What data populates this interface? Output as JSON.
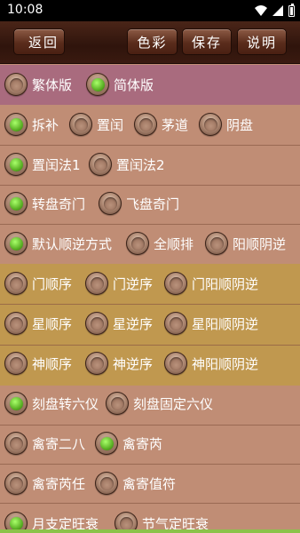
{
  "status_bar": {
    "time": "10:08"
  },
  "toolbar": {
    "back_label": "返回",
    "color_label": "色彩",
    "save_label": "保存",
    "help_label": "说明"
  },
  "options": {
    "script": [
      {
        "label": "繁体版",
        "checked": false
      },
      {
        "label": "简体版",
        "checked": true
      }
    ],
    "method1": [
      {
        "label": "拆补",
        "checked": true
      },
      {
        "label": "置闰",
        "checked": false
      },
      {
        "label": "茅道",
        "checked": false
      },
      {
        "label": "阴盘",
        "checked": false
      }
    ],
    "method2": [
      {
        "label": "置闰法1",
        "checked": true
      },
      {
        "label": "置闰法2",
        "checked": false
      }
    ],
    "plate": [
      {
        "label": "转盘奇门",
        "checked": true
      },
      {
        "label": "飞盘奇门",
        "checked": false
      }
    ],
    "order_mode": [
      {
        "label": "默认顺逆方式",
        "checked": true
      },
      {
        "label": "全顺排",
        "checked": false
      },
      {
        "label": "阳顺阴逆",
        "checked": false
      }
    ],
    "door_order": [
      {
        "label": "门顺序",
        "checked": false
      },
      {
        "label": "门逆序",
        "checked": false
      },
      {
        "label": "门阳顺阴逆",
        "checked": false
      }
    ],
    "star_order": [
      {
        "label": "星顺序",
        "checked": false
      },
      {
        "label": "星逆序",
        "checked": false
      },
      {
        "label": "星阳顺阴逆",
        "checked": false
      }
    ],
    "god_order": [
      {
        "label": "神顺序",
        "checked": false
      },
      {
        "label": "神逆序",
        "checked": false
      },
      {
        "label": "神阳顺阴逆",
        "checked": false
      }
    ],
    "liuyi": [
      {
        "label": "刻盘转六仪",
        "checked": true
      },
      {
        "label": "刻盘固定六仪",
        "checked": false
      }
    ],
    "qin1": [
      {
        "label": "禽寄二八",
        "checked": false
      },
      {
        "label": "禽寄芮",
        "checked": true
      }
    ],
    "qin2": [
      {
        "label": "禽寄芮任",
        "checked": false
      },
      {
        "label": "禽寄值符",
        "checked": false
      }
    ],
    "wangshuai": [
      {
        "label": "月支定旺衰",
        "checked": true
      },
      {
        "label": "节气定旺衰",
        "checked": false
      }
    ]
  }
}
